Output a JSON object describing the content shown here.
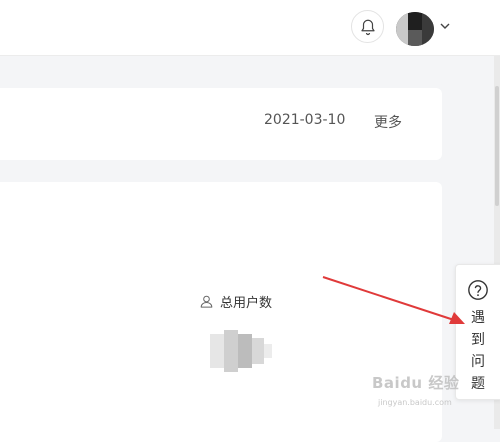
{
  "header": {
    "notification_icon": "bell-icon",
    "user_avatar": "avatar-image",
    "user_menu_icon": "chevron-down-icon"
  },
  "news_card": {
    "date": "2021-03-10",
    "more_label": "更多"
  },
  "stats_card": {
    "total_users_icon": "user-icon",
    "total_users_label": "总用户数"
  },
  "help_widget": {
    "icon": "question-circle-icon",
    "chars": [
      "遇",
      "到",
      "问",
      "题"
    ]
  },
  "annotation": {
    "arrow_color": "#e03a3a"
  },
  "watermark": {
    "text": "Baidu 经验",
    "subtext": "jingyan.baidu.com"
  }
}
